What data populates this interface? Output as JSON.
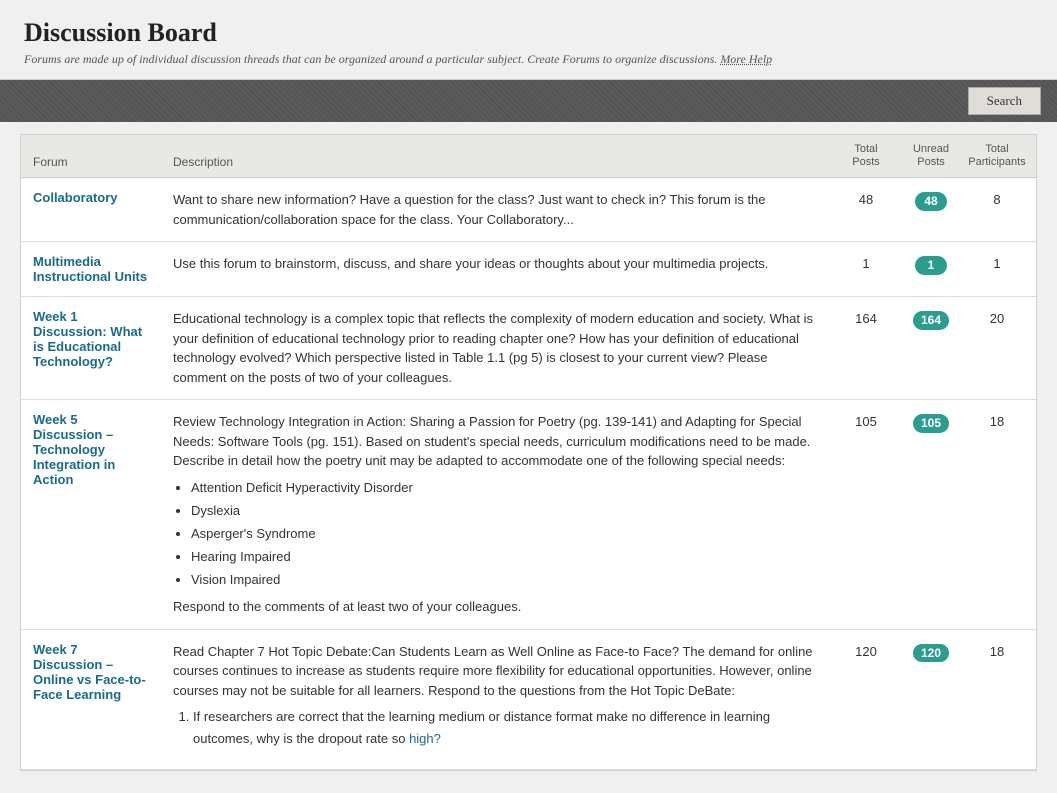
{
  "header": {
    "title": "Discussion Board",
    "subtitle": "Forums are made up of individual discussion threads that can be organized around a particular subject. Create Forums to organize discussions.",
    "more_help_label": "More Help"
  },
  "toolbar": {
    "search_label": "Search"
  },
  "table": {
    "columns": {
      "forum": "Forum",
      "description": "Description",
      "total_posts": "Total Posts",
      "unread_posts": "Unread Posts",
      "total_participants": "Total Participants"
    },
    "rows": [
      {
        "id": "collaboratory",
        "forum_name": "Collaboratory",
        "description": "Want to share new information? Have a question for the class? Just want to check in? This forum is the communication/collaboration space for the class. Your Collaboratory...",
        "total_posts": "48",
        "unread_posts": "48",
        "total_participants": "8",
        "list_items": [],
        "ordered_items": []
      },
      {
        "id": "multimedia-instructional-units",
        "forum_name": "Multimedia Instructional Units",
        "description": "Use this forum to brainstorm, discuss, and share your ideas or thoughts about your multimedia projects.",
        "total_posts": "1",
        "unread_posts": "1",
        "total_participants": "1",
        "list_items": [],
        "ordered_items": []
      },
      {
        "id": "week1-discussion",
        "forum_name": "Week 1 Discussion: What is Educational Technology?",
        "description": "Educational technology is a complex topic that reflects the complexity of modern education and society. What is your definition of educational technology prior to reading chapter one?  How has your definition of educational technology evolved?  Which perspective listed in Table 1.1 (pg 5) is closest to your current view?  Please comment on the posts of two of your colleagues.",
        "total_posts": "164",
        "unread_posts": "164",
        "total_participants": "20",
        "list_items": [],
        "ordered_items": []
      },
      {
        "id": "week5-discussion",
        "forum_name": "Week 5 Discussion – Technology Integration in Action",
        "description": "Review Technology Integration in Action: Sharing a Passion for Poetry (pg. 139-141) and Adapting for Special Needs: Software Tools (pg. 151). Based on student's special needs, curriculum modifications need to be made. Describe in detail how the poetry unit may be adapted to accommodate one of the following special needs:",
        "total_posts": "105",
        "unread_posts": "105",
        "total_participants": "18",
        "list_items": [
          "Attention Deficit Hyperactivity Disorder",
          "Dyslexia",
          "Asperger's Syndrome",
          "Hearing Impaired",
          "Vision Impaired"
        ],
        "after_list": "Respond to the comments of at least two of your colleagues.",
        "ordered_items": []
      },
      {
        "id": "week7-discussion",
        "forum_name": "Week 7 Discussion – Online vs Face-to-Face Learning",
        "description": "Read Chapter 7 Hot Topic Debate:Can Students Learn as Well Online as Face-to Face? The demand for online courses continues to increase as students require more flexibility for educational opportunities. However, online courses may not be suitable for all learners.  Respond to the questions from the Hot Topic DeBate:",
        "total_posts": "120",
        "unread_posts": "120",
        "total_participants": "18",
        "list_items": [],
        "ordered_items": [
          "If researchers are correct that the learning medium or distance format make no difference in learning outcomes, why is the dropout rate so high?"
        ]
      }
    ]
  }
}
